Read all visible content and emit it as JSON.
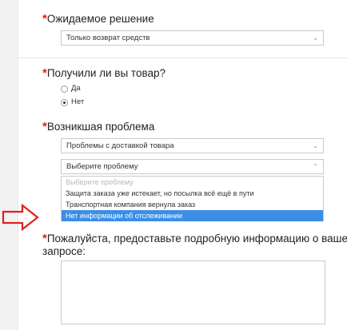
{
  "expected_solution": {
    "heading": "Ожидаемое решение",
    "required_mark": "*",
    "selected": "Только возврат средств"
  },
  "received_item": {
    "heading": "Получили ли вы товар?",
    "required_mark": "*",
    "options": [
      "Да",
      "Нет"
    ],
    "selected": "Нет"
  },
  "problem": {
    "heading": "Возникшая проблема",
    "required_mark": "*",
    "category_selected": "Проблемы с доставкой товара",
    "problem_placeholder": "Выберите проблему",
    "dropdown_options": [
      "Выберите проблему",
      "Защита заказа уже истекает, но посылка всё ещё в пути",
      "Транспортная компания вернула заказ",
      "Нет информации об отслеживании"
    ],
    "highlighted_option": "Нет информации об отслеживании"
  },
  "details": {
    "heading_line1": "Пожалуйста, предоставьте подробную информацию о вашем",
    "heading_line2": "запросе:",
    "required_mark": "*"
  },
  "colors": {
    "required": "#e0211a",
    "highlight": "#3b8ee6",
    "callout_arrow": "#e0211a"
  },
  "icons": {
    "dropdown_closed": "chevron-down-icon",
    "dropdown_open": "chevron-up-icon",
    "callout": "right-arrow-icon"
  }
}
